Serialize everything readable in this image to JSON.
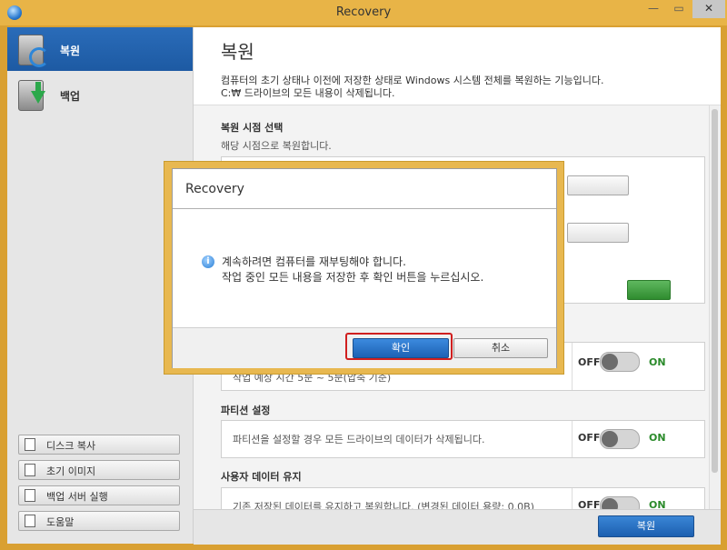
{
  "window": {
    "title": "Recovery",
    "minimize": "—",
    "maximize": "▭",
    "close": "✕"
  },
  "sidebar": {
    "items": [
      {
        "label": "복원",
        "icon": "restore-drive-icon",
        "active": true
      },
      {
        "label": "백업",
        "icon": "backup-drive-icon",
        "active": false
      }
    ],
    "tools": [
      {
        "label": "디스크 복사",
        "icon": "disk-copy-icon"
      },
      {
        "label": "초기 이미지",
        "icon": "initial-image-icon"
      },
      {
        "label": "백업 서버 실행",
        "icon": "backup-server-icon"
      },
      {
        "label": "도움말",
        "icon": "help-icon"
      }
    ]
  },
  "main": {
    "title": "복원",
    "desc1": "컴퓨터의 초기 상태나 이전에 저장한 상태로 Windows 시스템 전체를 복원하는 기능입니다.",
    "desc2": "C:₩ 드라이브의 모든 내용이 삭제됩니다.",
    "restore_point": {
      "title": "복원 시점 선택",
      "subtitle": "해당 시점으로 복원합니다."
    },
    "partial_text": "작업 예상 시간 5분 ~ 5분(압축 기준)",
    "partition": {
      "title": "파티션 설정",
      "text": "파티션을 설정할 경우 모든 드라이브의 데이터가 삭제됩니다."
    },
    "user_data": {
      "title": "사용자 데이터 유지",
      "text": "기존 저장된 데이터를 유지하고 복원합니다. (변경된 데이터 용량: 0.0B)"
    },
    "toggle": {
      "off": "OFF",
      "on": "ON"
    },
    "restore_button": "복원"
  },
  "dialog": {
    "title": "Recovery",
    "message_line1": "계속하려면 컴퓨터를 재부팅해야 합니다.",
    "message_line2": "작업 중인 모든 내용을 저장한 후 확인 버튼을 누르십시오.",
    "ok": "확인",
    "cancel": "취소"
  },
  "colors": {
    "accent": "#1d5aa3",
    "frame": "#e8b850",
    "highlight": "#d01f1f",
    "on_green": "#2a8a2a"
  }
}
